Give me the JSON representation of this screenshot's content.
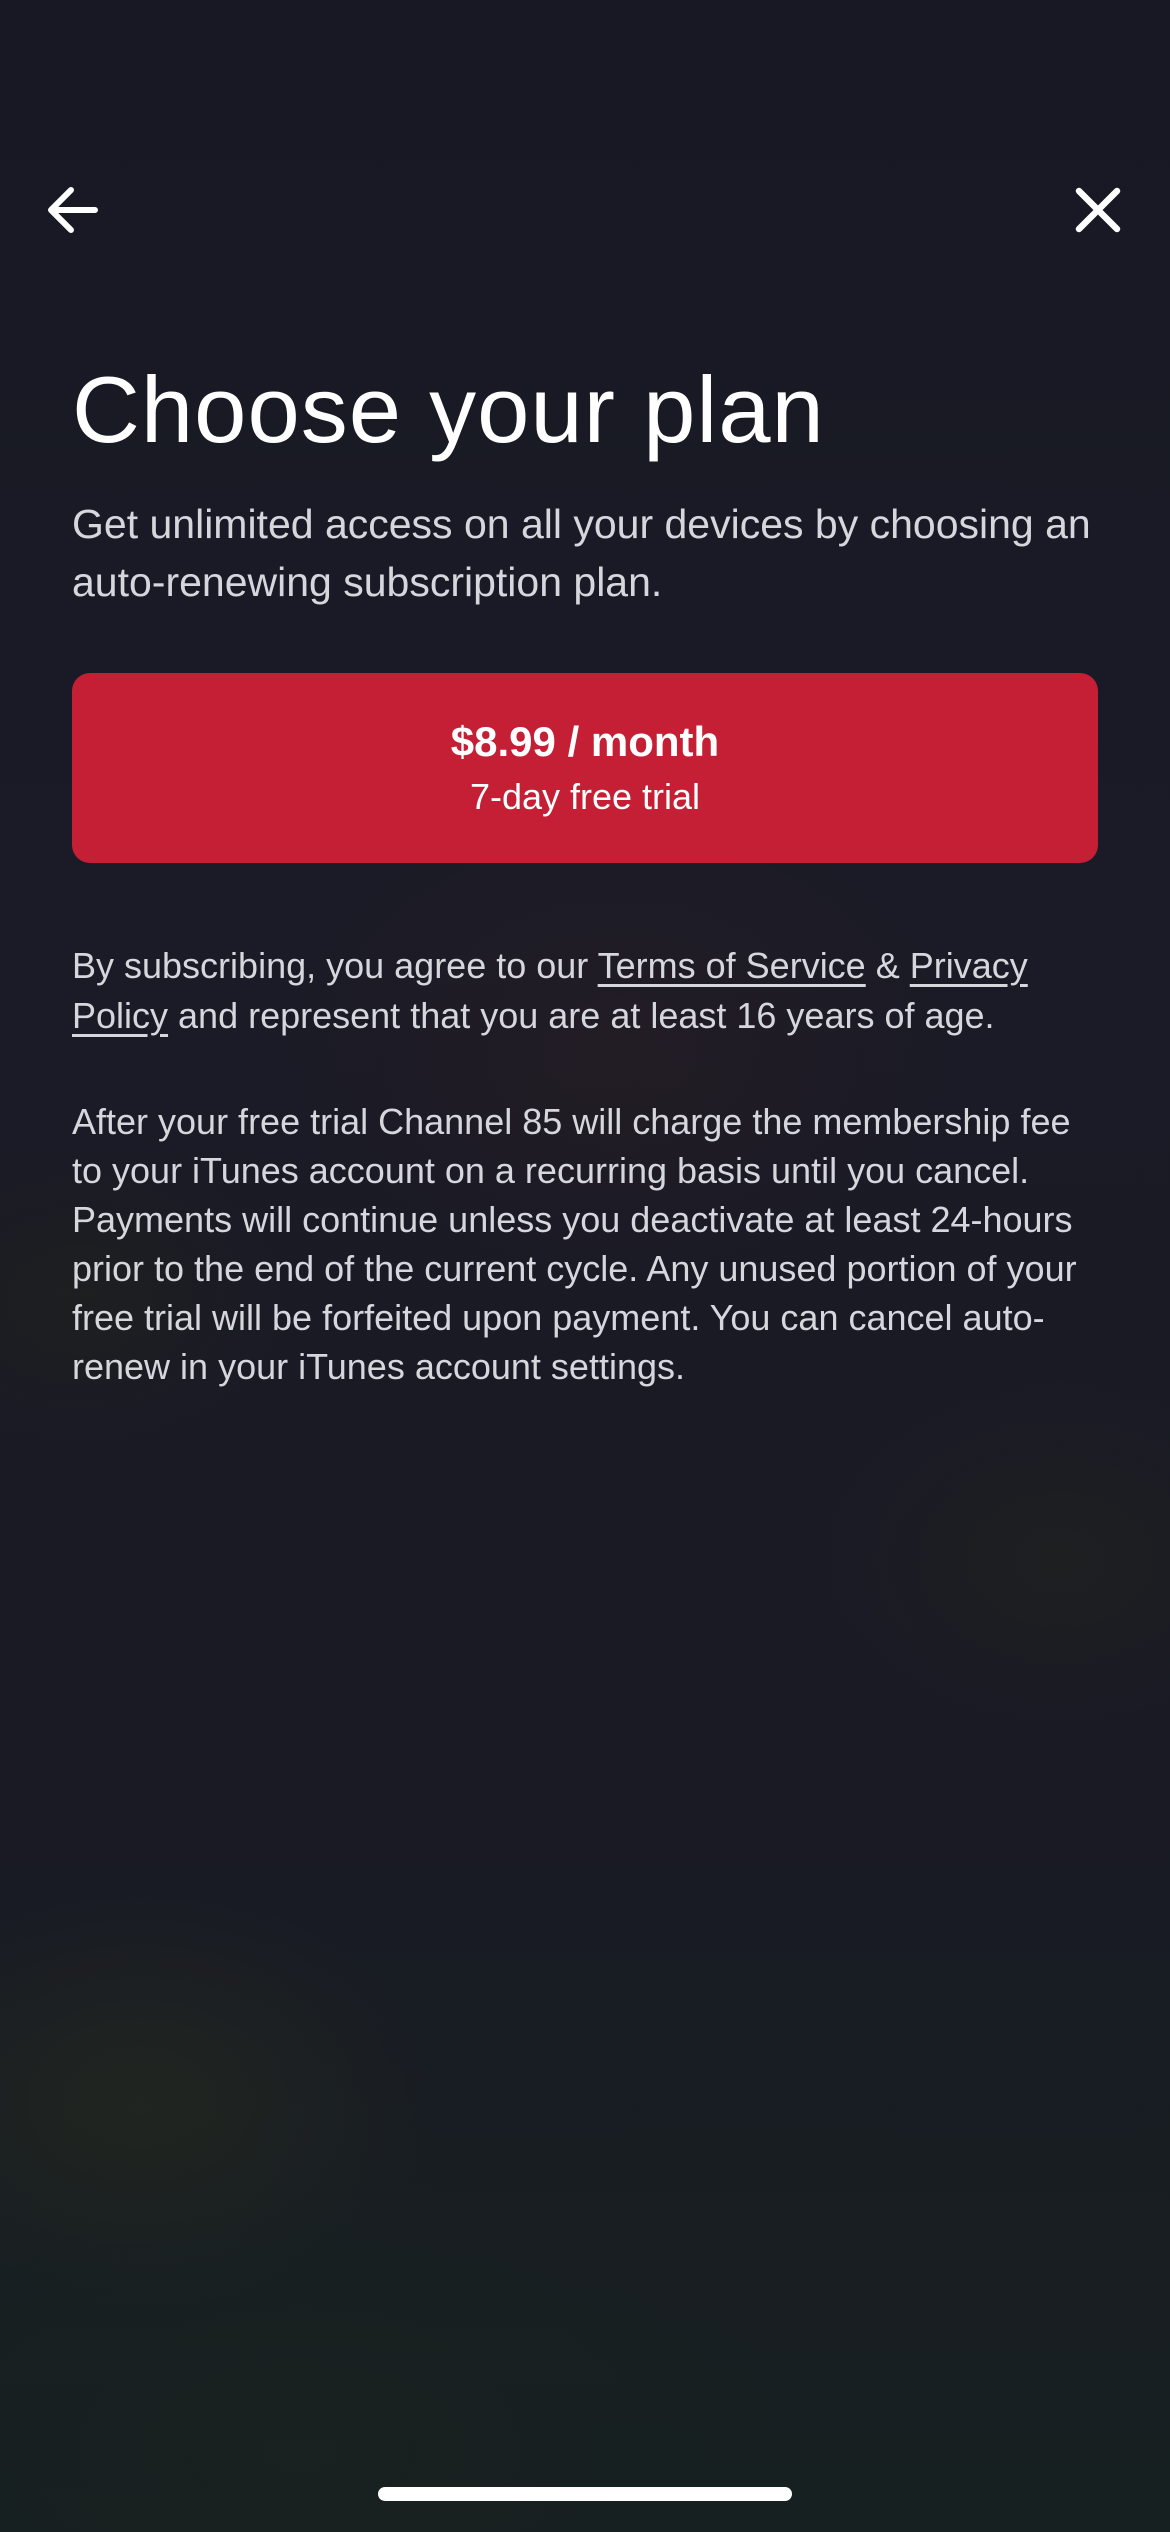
{
  "nav": {
    "back_icon": "arrow-left-icon",
    "close_icon": "close-icon"
  },
  "header": {
    "title": "Choose your plan",
    "subtitle": "Get unlimited access on all your devices by choosing an auto-renewing subscription plan."
  },
  "plan": {
    "price": "$8.99 / month",
    "trial": "7-day free trial",
    "color": "#c41f35"
  },
  "legal": {
    "prefix": "By subscribing, you agree to our ",
    "terms_link": "Terms of Service",
    "ampersand": " & ",
    "privacy_link": "Privacy Policy",
    "suffix": " and represent that you are at least 16 years of age."
  },
  "renewal_notice": "After your free trial Channel 85 will charge the membership fee to your iTunes account on a recurring basis until you cancel. Payments will continue unless you deactivate at least 24-hours prior to the end of the current cycle. Any unused portion of your free trial will be forfeited upon payment. You can cancel auto-renew in your iTunes account settings."
}
